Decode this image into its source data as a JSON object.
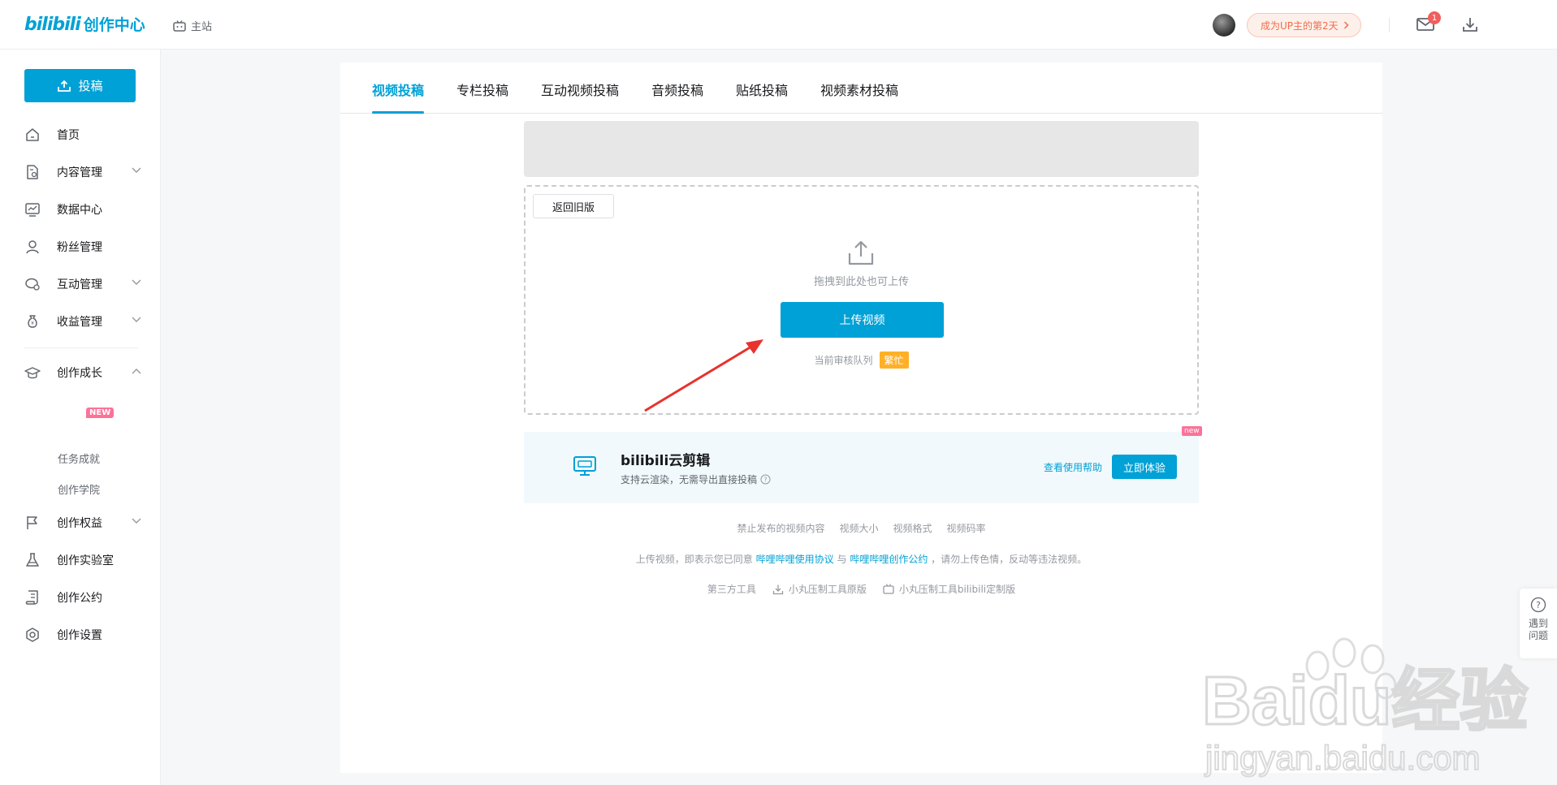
{
  "header": {
    "logo_brand": "bilibili",
    "logo_suffix": "创作中心",
    "home_link": "主站",
    "up_pill": "成为UP主的第2天",
    "mail_badge": "1"
  },
  "sidebar": {
    "upload_button": "投稿",
    "items": [
      {
        "label": "首页",
        "icon": "home-icon"
      },
      {
        "label": "内容管理",
        "icon": "document-icon"
      },
      {
        "label": "数据中心",
        "icon": "chart-icon"
      },
      {
        "label": "粉丝管理",
        "icon": "user-icon"
      },
      {
        "label": "互动管理",
        "icon": "chat-icon"
      },
      {
        "label": "收益管理",
        "icon": "money-bag-icon"
      },
      {
        "label": "创作成长",
        "icon": "graduation-cap-icon"
      },
      {
        "label": "创作权益",
        "icon": "flag-icon"
      },
      {
        "label": "创作实验室",
        "icon": "flask-icon"
      },
      {
        "label": "创作公约",
        "icon": "scroll-icon"
      },
      {
        "label": "创作设置",
        "icon": "settings-icon"
      }
    ],
    "growth_subitems": [
      "任务成就",
      "创作学院"
    ],
    "new_tag": "NEW"
  },
  "tabs": [
    "视频投稿",
    "专栏投稿",
    "互动视频投稿",
    "音频投稿",
    "贴纸投稿",
    "视频素材投稿"
  ],
  "upload": {
    "back_button": "返回旧版",
    "drop_hint": "拖拽到此处也可上传",
    "upload_button": "上传视频",
    "queue_label": "当前审核队列",
    "queue_status": "繁忙"
  },
  "promo": {
    "title": "bilibili云剪辑",
    "subtitle": "支持云渲染，无需导出直接投稿",
    "help_link": "查看使用帮助",
    "try_button": "立即体验",
    "new_corner": "new"
  },
  "footer": {
    "links": [
      "禁止发布的视频内容",
      "视频大小",
      "视频格式",
      "视频码率"
    ],
    "agree_prefix": "上传视频，即表示您已同意",
    "agree_link1": "哔哩哔哩使用协议",
    "agree_and": "与",
    "agree_link2": "哔哩哔哩创作公约",
    "agree_suffix": "，请勿上传色情，反动等违法视频。",
    "tools_label": "第三方工具",
    "tool1": "小丸压制工具原版",
    "tool2": "小丸压制工具bilibili定制版"
  },
  "help_float": "遇到问题",
  "watermark": {
    "brand": "Baidu经验",
    "url": "jingyan.baidu.com"
  },
  "colors": {
    "accent": "#00a1d6",
    "busy": "#ffb027",
    "pink": "#fb7299",
    "arrow": "#e8322d"
  }
}
